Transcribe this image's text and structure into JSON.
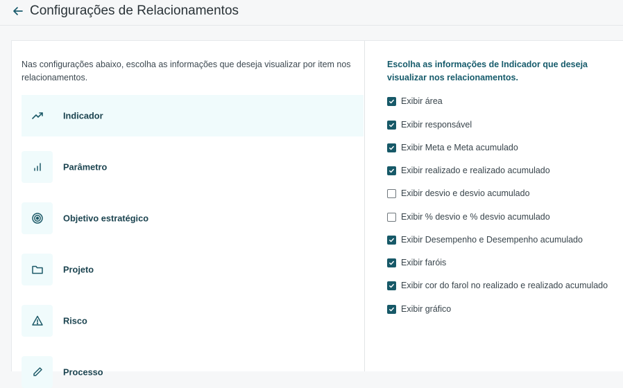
{
  "header": {
    "title": "Configurações de Relacionamentos",
    "back_icon": "arrow-left-icon"
  },
  "left_panel": {
    "description": "Nas configurações abaixo, escolha as informações que deseja visualizar por item nos relacionamentos.",
    "items": [
      {
        "label": "Indicador",
        "icon": "trend-up-icon",
        "active": true
      },
      {
        "label": "Parâmetro",
        "icon": "bar-chart-icon",
        "active": false
      },
      {
        "label": "Objetivo estratégico",
        "icon": "target-icon",
        "active": false
      },
      {
        "label": "Projeto",
        "icon": "folder-icon",
        "active": false
      },
      {
        "label": "Risco",
        "icon": "warning-icon",
        "active": false
      },
      {
        "label": "Processo",
        "icon": "pencil-icon",
        "active": false
      }
    ]
  },
  "right_panel": {
    "title": "Escolha as informações de Indicador que deseja visualizar nos relacionamentos.",
    "options": [
      {
        "label": "Exibir área",
        "checked": true
      },
      {
        "label": "Exibir responsável",
        "checked": true
      },
      {
        "label": "Exibir Meta e Meta acumulado",
        "checked": true
      },
      {
        "label": "Exibir realizado e realizado acumulado",
        "checked": true
      },
      {
        "label": "Exibir desvio e desvio acumulado",
        "checked": false
      },
      {
        "label": "Exibir % desvio e % desvio acumulado",
        "checked": false
      },
      {
        "label": "Exibir Desempenho e Desempenho acumulado",
        "checked": true
      },
      {
        "label": "Exibir faróis",
        "checked": true
      },
      {
        "label": "Exibir cor do farol no realizado e realizado acumulado",
        "checked": true
      },
      {
        "label": "Exibir gráfico",
        "checked": true
      }
    ]
  },
  "colors": {
    "accent": "#175968",
    "active_bg": "#f0fbfc"
  }
}
